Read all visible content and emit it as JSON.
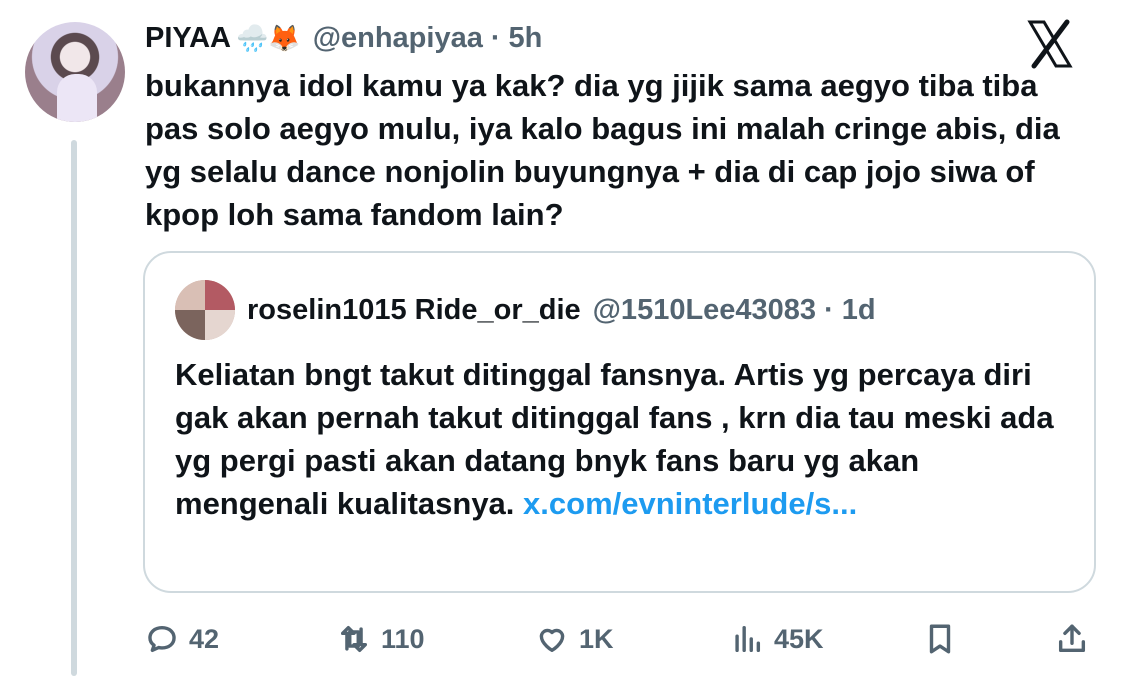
{
  "tweet": {
    "display_name": "PIYAA",
    "name_emojis": "🌧️🦊",
    "handle": "@enhapiyaa",
    "dot": "·",
    "time": "5h",
    "text": "bukannya idol kamu ya kak? dia yg jijik sama aegyo tiba tiba pas solo aegyo mulu, iya kalo bagus ini malah cringe abis, dia yg selalu dance nonjolin buyungnya + dia di cap jojo siwa of kpop loh sama fandom lain?"
  },
  "quote": {
    "display_name": "roselin1015 Ride_or_die",
    "handle": "@1510Lee43083",
    "dot": "·",
    "time": "1d",
    "text": "Keliatan bngt takut ditinggal fansnya.  Artis yg percaya diri gak akan pernah takut ditinggal fans , krn dia tau meski ada yg pergi pasti akan datang bnyk fans baru yg akan mengenali kualitasnya.",
    "link": "x.com/​evninterlude/s..."
  },
  "actions": {
    "replies": "42",
    "reposts": "110",
    "likes": "1K",
    "views": "45K",
    "icons": [
      "reply-icon",
      "repost-icon",
      "like-icon",
      "views-icon",
      "bookmark-icon",
      "share-icon"
    ]
  },
  "colors": {
    "text": "#0f1419",
    "secondary": "#536471",
    "link": "#1d9bf0",
    "border": "#cfd9de"
  }
}
